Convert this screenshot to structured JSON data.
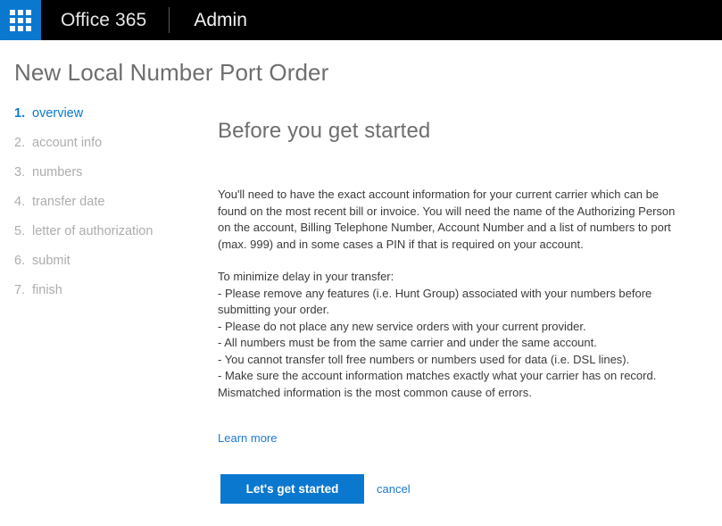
{
  "suite_bar": {
    "waffle_icon": "app-launcher-waffle-icon",
    "brand": "Office 365",
    "app": "Admin"
  },
  "page": {
    "title": "New Local Number Port Order"
  },
  "wizard": {
    "steps": [
      {
        "number": "1.",
        "label": "overview",
        "active": true
      },
      {
        "number": "2.",
        "label": "account info",
        "active": false
      },
      {
        "number": "3.",
        "label": "numbers",
        "active": false
      },
      {
        "number": "4.",
        "label": "transfer date",
        "active": false
      },
      {
        "number": "5.",
        "label": "letter of authorization",
        "active": false
      },
      {
        "number": "6.",
        "label": "submit",
        "active": false
      },
      {
        "number": "7.",
        "label": "finish",
        "active": false
      }
    ]
  },
  "main": {
    "heading": "Before you get started",
    "intro": "You'll need to have the exact account information for your current carrier which can be found on the most recent bill or invoice. You will need the name of the Authorizing Person on the account, Billing Telephone Number, Account Number and a list of numbers to port (max. 999) and in some cases a PIN if that is required on your account.",
    "tips_heading": "To minimize delay in your transfer:",
    "tips": [
      "- Please remove any features (i.e. Hunt Group) associated with your numbers before submitting your order.",
      "- Please do not place any new service orders with your current provider.",
      "- All numbers must be from the same carrier and under the same account.",
      "- You cannot transfer toll free numbers or numbers used for data (i.e. DSL lines).",
      "- Make sure the account information matches exactly what your carrier has on record. Mismatched information is the most common cause of errors."
    ],
    "learn_more": "Learn more"
  },
  "actions": {
    "primary": "Let's get started",
    "cancel": "cancel"
  },
  "colors": {
    "accent_blue": "#0b78d0",
    "link_blue": "#1b7bd0",
    "header_black": "#000000",
    "title_gray": "#6e6e6e",
    "step_gray": "#adadad",
    "body_gray": "#3b3b3b"
  }
}
